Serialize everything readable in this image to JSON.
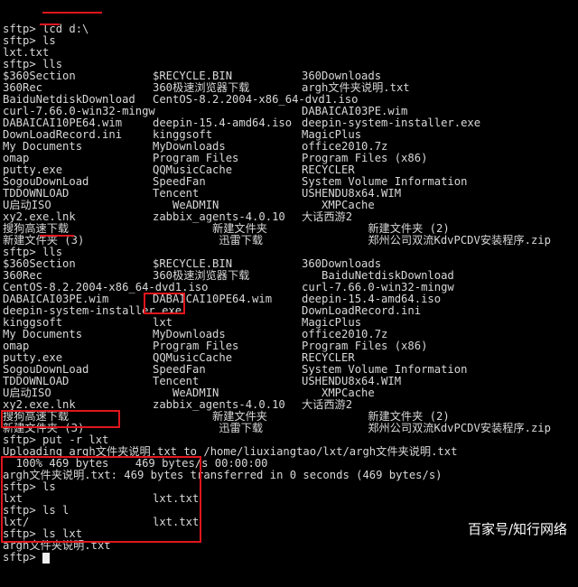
{
  "terminal": {
    "lines": [
      [
        "sftp> lcd d:\\"
      ],
      [
        "sftp> ls"
      ],
      [
        "lxt.txt"
      ],
      [
        "sftp> lls"
      ],
      [
        "$360Section",
        "$RECYCLE.BIN",
        "360Downloads"
      ],
      [
        "360Rec",
        "360极速浏览器下载",
        "argh文件夹说明.txt"
      ],
      [
        "BaiduNetdiskDownload",
        "CentOS-8.2.2004-x86_64-dvd1.iso"
      ],
      [
        "curl-7.66.0-win32-mingw",
        "",
        "DABAICAI03PE.wim"
      ],
      [
        "DABAICAI10PE64.wim",
        "deepin-15.4-amd64.iso",
        "deepin-system-installer.exe"
      ],
      [
        "DownLoadRecord.ini",
        "kinggsoft",
        "MagicPlus"
      ],
      [
        "My Documents",
        "MyDownloads",
        "office2010.7z"
      ],
      [
        "omap",
        "Program Files",
        "Program Files (x86)"
      ],
      [
        "putty.exe",
        "QQMusicCache",
        "RECYCLER"
      ],
      [
        "SogouDownLoad",
        "SpeedFan",
        "System Volume Information"
      ],
      [
        "TDDOWNLOAD",
        "Tencent",
        "USHENDU8x64.WIM"
      ],
      [
        "U启动ISO",
        "   WeADMIN",
        "   XMPCache"
      ],
      [
        "xy2.exe.lnk",
        "zabbix_agents-4.0.10",
        "大话西游2"
      ],
      [
        "搜狗高速下载",
        "         新建文件夹",
        "          新建文件夹 (2)"
      ],
      [
        "新建文件夹 (3)",
        "          迅雷下载",
        "          郑州公司双流KdvPCDV安装程序.zip"
      ],
      [
        "sftp> lls"
      ],
      [
        "$360Section",
        "$RECYCLE.BIN",
        "360Downloads"
      ],
      [
        "360Rec",
        "360极速浏览器下载",
        "   BaiduNetdiskDownload"
      ],
      [
        "CentOS-8.2.2004-x86_64-dvd1.iso",
        "",
        "curl-7.66.0-win32-mingw"
      ],
      [
        "DABAICAI03PE.wim",
        "DABAICAI10PE64.wim",
        "deepin-15.4-amd64.iso"
      ],
      [
        "deepin-system-installer.exe",
        "",
        "DownLoadRecord.ini"
      ],
      [
        "kinggsoft",
        "lxt",
        "MagicPlus"
      ],
      [
        "My Documents",
        "MyDownloads",
        "office2010.7z"
      ],
      [
        "omap",
        "Program Files",
        "Program Files (x86)"
      ],
      [
        "putty.exe",
        "QQMusicCache",
        "RECYCLER"
      ],
      [
        "SogouDownLoad",
        "SpeedFan",
        "System Volume Information"
      ],
      [
        "TDDOWNLOAD",
        "Tencent",
        "USHENDU8x64.WIM"
      ],
      [
        "U启动ISO",
        "   WeADMIN",
        "   XMPCache"
      ],
      [
        "xy2.exe.lnk",
        "zabbix_agents-4.0.10",
        "大话西游2"
      ],
      [
        "搜狗高速下载",
        "         新建文件夹",
        "          新建文件夹 (2)"
      ],
      [
        "新建文件夹 (3)",
        "          迅雷下载",
        "          郑州公司双流KdvPCDV安装程序.zip"
      ],
      [
        "sftp> put -r lxt"
      ],
      [
        "Uploading argh文件夹说明.txt to /home/liuxiangtao/lxt/argh文件夹说明.txt"
      ],
      [
        "  100% 469 bytes    469 bytes/s 00:00:00"
      ],
      [
        "argh文件夹说明.txt: 469 bytes transferred in 0 seconds (469 bytes/s)"
      ],
      [
        "sftp> ls"
      ],
      [
        "lxt",
        "lxt.txt"
      ],
      [
        "sftp> ls l"
      ],
      [
        "lxt/",
        "lxt.txt"
      ],
      [
        "sftp> ls lxt"
      ],
      [
        "argh文件夹说明.txt"
      ],
      [
        "sftp> "
      ]
    ]
  },
  "watermark": "百家号/知行网络",
  "colors": {
    "background": "#000000",
    "text": "#d8d8d8",
    "annotation": "#e0161d"
  }
}
